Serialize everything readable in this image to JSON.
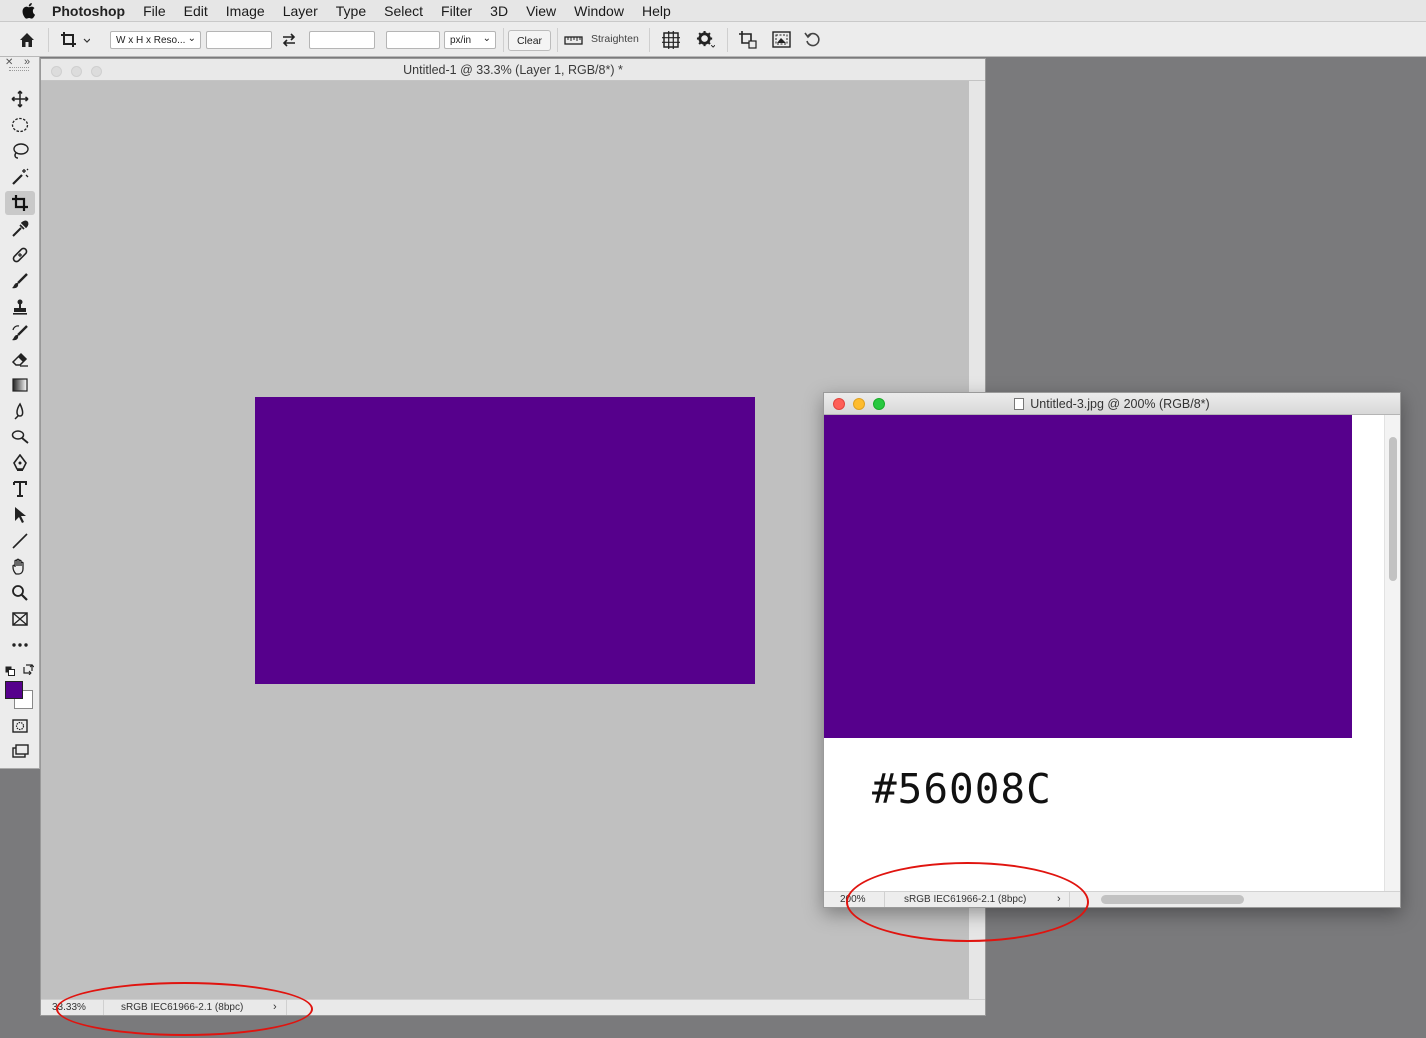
{
  "menubar": {
    "app_name": "Photoshop",
    "items": [
      "File",
      "Edit",
      "Image",
      "Layer",
      "Type",
      "Select",
      "Filter",
      "3D",
      "View",
      "Window",
      "Help"
    ]
  },
  "options": {
    "preset_label": "W x H x Reso...",
    "width_value": "",
    "height_value": "",
    "resolution_value": "",
    "units_label": "px/in",
    "clear_label": "Clear",
    "straighten_label": "Straighten"
  },
  "tools": [
    "move-tool-icon",
    "marquee-tool-icon",
    "lasso-tool-icon",
    "magic-wand-icon",
    "crop-tool-icon",
    "eyedropper-icon",
    "healing-brush-icon",
    "brush-icon",
    "stamp-icon",
    "history-brush-icon",
    "eraser-icon",
    "gradient-icon",
    "blur-icon",
    "dodge-icon",
    "pen-icon",
    "type-icon",
    "path-select-icon",
    "line-icon",
    "hand-icon",
    "zoom-icon",
    "frame-icon",
    "more-tools-icon"
  ],
  "colors": {
    "foreground": "#56008C",
    "background": "#FFFFFF",
    "annotation": "#E0140F"
  },
  "doc1": {
    "title": "Untitled-1 @ 33.3% (Layer 1, RGB/8*) *",
    "zoom": "33.33%",
    "profile": "sRGB IEC61966-2.1 (8bpc)",
    "arrow": "›"
  },
  "doc2": {
    "title": "Untitled-3.jpg @ 200% (RGB/8*)",
    "hex_text": "#56008C",
    "zoom": "200%",
    "profile": "sRGB IEC61966-2.1 (8bpc)",
    "arrow": "›"
  }
}
